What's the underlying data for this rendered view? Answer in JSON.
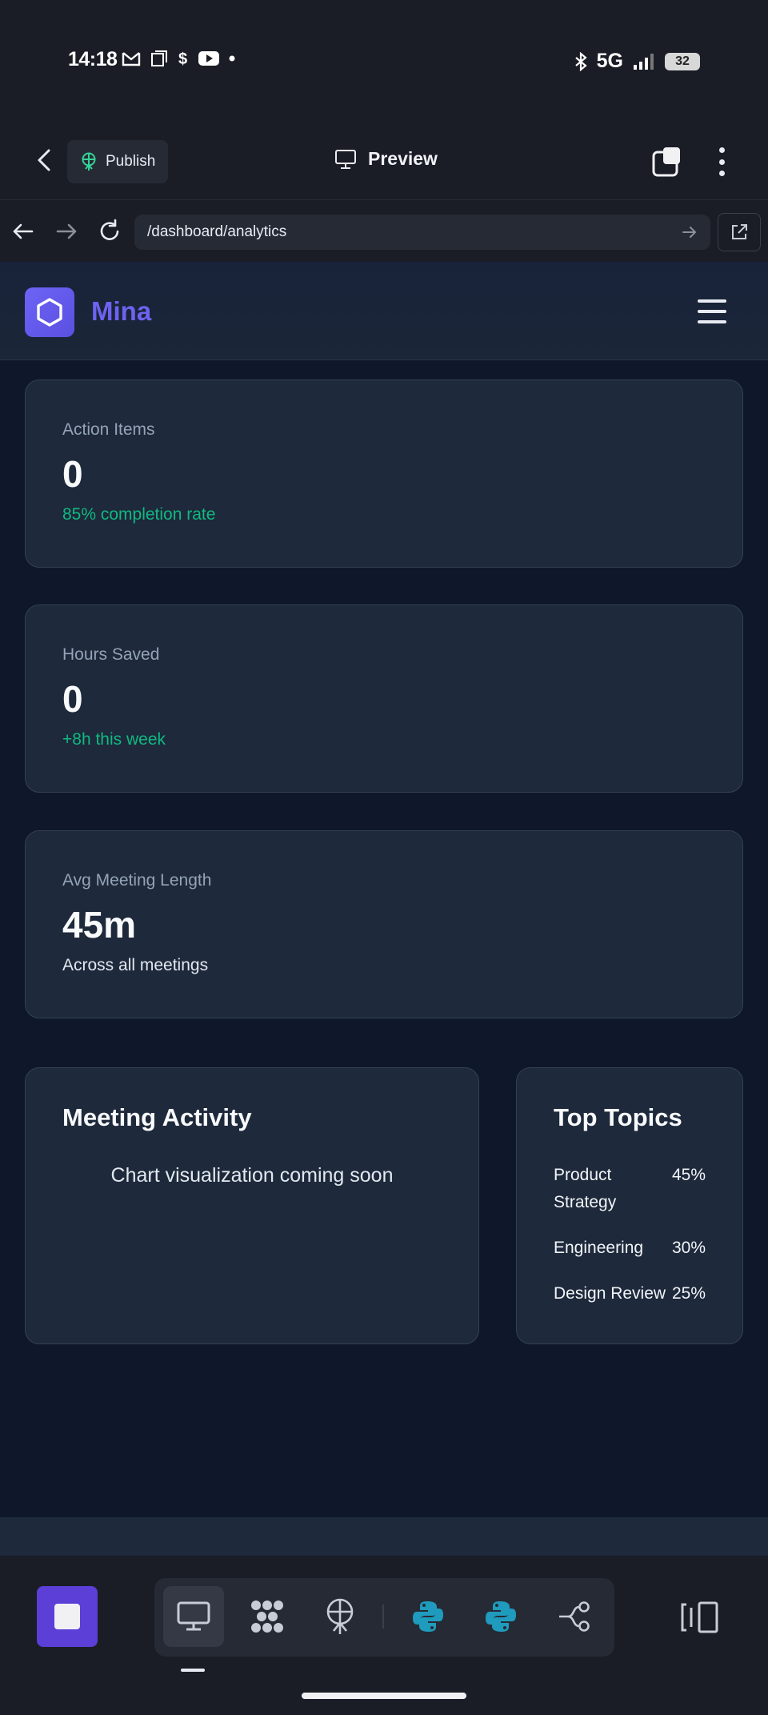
{
  "status_bar": {
    "time": "14:18",
    "network": "5G",
    "battery": "32"
  },
  "top_bar": {
    "publish_label": "Publish",
    "preview_label": "Preview"
  },
  "url_bar": {
    "url": "/dashboard/analytics"
  },
  "site": {
    "brand": "Mina"
  },
  "stats": [
    {
      "label": "Action Items",
      "value": "0",
      "sub": "85% completion rate",
      "sub_color": "#10b981"
    },
    {
      "label": "Hours Saved",
      "value": "0",
      "sub": "+8h this week",
      "sub_color": "#10b981"
    },
    {
      "label": "Avg Meeting Length",
      "value": "45m",
      "sub": "Across all meetings",
      "sub_color": "#e2e8f0"
    }
  ],
  "meeting_activity": {
    "title": "Meeting Activity",
    "placeholder": "Chart visualization coming soon"
  },
  "top_topics": {
    "title": "Top Topics",
    "items": [
      {
        "name": "Product Strategy",
        "percent": "45%"
      },
      {
        "name": "Engineering",
        "percent": "30%"
      },
      {
        "name": "Design Review",
        "percent": "25%"
      }
    ]
  },
  "colors": {
    "accent": "#6e62f0",
    "positive": "#10b981",
    "card_bg": "#1e293b",
    "page_bg": "#0f172a"
  },
  "icons": {
    "toolbar": [
      "monitor-icon",
      "grid-dots-icon",
      "deploy-icon",
      "python-icon",
      "python-icon",
      "branch-icon"
    ]
  }
}
